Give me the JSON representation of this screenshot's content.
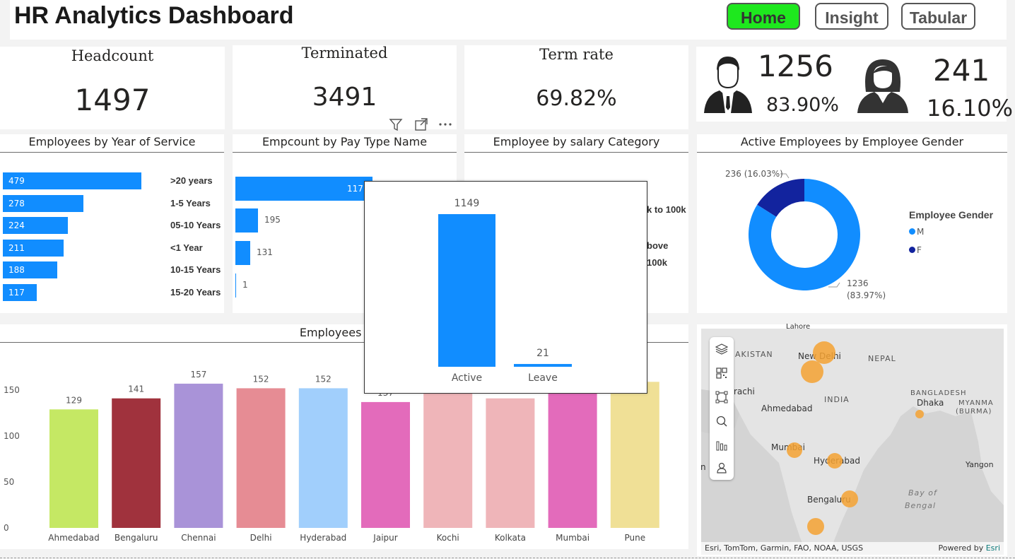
{
  "header": {
    "title": "HR Analytics Dashboard",
    "nav": [
      {
        "label": "Home",
        "active": true
      },
      {
        "label": "Insight",
        "active": false
      },
      {
        "label": "Tabular",
        "active": false
      }
    ]
  },
  "kpis": {
    "headcount": {
      "label": "Headcount",
      "value": "1497"
    },
    "terminated": {
      "label": "Terminated",
      "value": "3491"
    },
    "term_rate": {
      "label": "Term rate",
      "value": "69.82%"
    }
  },
  "gender_kpi": {
    "male": {
      "count": "1256",
      "pct": "83.90%",
      "icon": "male-avatar-icon"
    },
    "female": {
      "count": "241",
      "pct": "16.10%",
      "icon": "female-avatar-icon"
    }
  },
  "visual_header_icons": [
    "filter-icon",
    "focus-mode-icon",
    "more-options-icon"
  ],
  "charts": {
    "year_of_service": {
      "title": "Employees by Year of Service",
      "chart_data": {
        "type": "bar",
        "orientation": "horizontal",
        "categories": [
          ">20 years",
          "1-5 Years",
          "05-10 Years",
          "<1 Year",
          "10-15 Years",
          "15-20 Years"
        ],
        "values": [
          479,
          278,
          224,
          211,
          188,
          117
        ]
      }
    },
    "pay_type": {
      "title": "Empcount by Pay Type Name",
      "chart_data": {
        "type": "bar",
        "orientation": "horizontal",
        "values": [
          1170,
          195,
          131,
          1
        ],
        "value_labels": [
          "117",
          "195",
          "131",
          "1"
        ]
      }
    },
    "salary_category": {
      "title": "Employee by salary Category",
      "visible_categories": [
        "k to 100k",
        "bove 100k"
      ]
    },
    "gender_donut": {
      "title": "Active Employees by Employee Gender",
      "legend_title": "Employee Gender",
      "chart_data": {
        "type": "pie",
        "donut": true,
        "categories": [
          "M",
          "F"
        ],
        "values": [
          1236,
          236
        ],
        "labels": [
          "1236",
          "236 (16.03%)"
        ],
        "pct_labels": [
          "(83.97%)",
          ""
        ],
        "colors": [
          "#118dff",
          "#12239e"
        ]
      }
    },
    "location": {
      "title": "Employees by L",
      "chart_data": {
        "type": "bar",
        "categories": [
          "Ahmedabad",
          "Bengaluru",
          "Chennai",
          "Delhi",
          "Hyderabad",
          "Jaipur",
          "Kochi",
          "Kolkata",
          "Mumbai",
          "Pune"
        ],
        "values": [
          129,
          141,
          157,
          152,
          152,
          137,
          152,
          141,
          152,
          159
        ],
        "value_labels": [
          "129",
          "141",
          "157",
          "152",
          "152",
          "137",
          "",
          "",
          "",
          ""
        ],
        "colors": [
          "#c5e864",
          "#a0323d",
          "#a993d8",
          "#e68c94",
          "#a1cffc",
          "#e36bbb",
          "#efb5b9",
          "#efb5b9",
          "#e36bbb",
          "#f0e096"
        ],
        "yticks": [
          0,
          50,
          100,
          150
        ],
        "ylim": [
          0,
          175
        ]
      }
    },
    "tooltip_popup": {
      "chart_data": {
        "type": "bar",
        "categories": [
          "Active",
          "Leave"
        ],
        "values": [
          1149,
          21
        ],
        "colors": [
          "#118dff",
          "#118dff"
        ]
      }
    }
  },
  "map": {
    "tools": [
      "layers-icon",
      "qr-select-icon",
      "rect-select-icon",
      "search-icon",
      "bar-chart-icon",
      "person-icon"
    ],
    "place_labels": [
      "New Delhi",
      "Ahmedabad",
      "Mumbai",
      "Hyderabad",
      "Bengaluru",
      "Dhaka",
      "INDIA",
      "NEPAL",
      "BANGLADESH",
      "MYANMA",
      "(BURMA)",
      "Yangon",
      "Bay of",
      "Bengal",
      "AKISTAN",
      "rachi",
      "Lahore",
      "n"
    ],
    "attribution": "Esri, TomTom, Garmin, FAO, NOAA, USGS",
    "powered_by": "Powered by",
    "powered_brand": "Esri",
    "bubble_color": "#f5a233"
  }
}
